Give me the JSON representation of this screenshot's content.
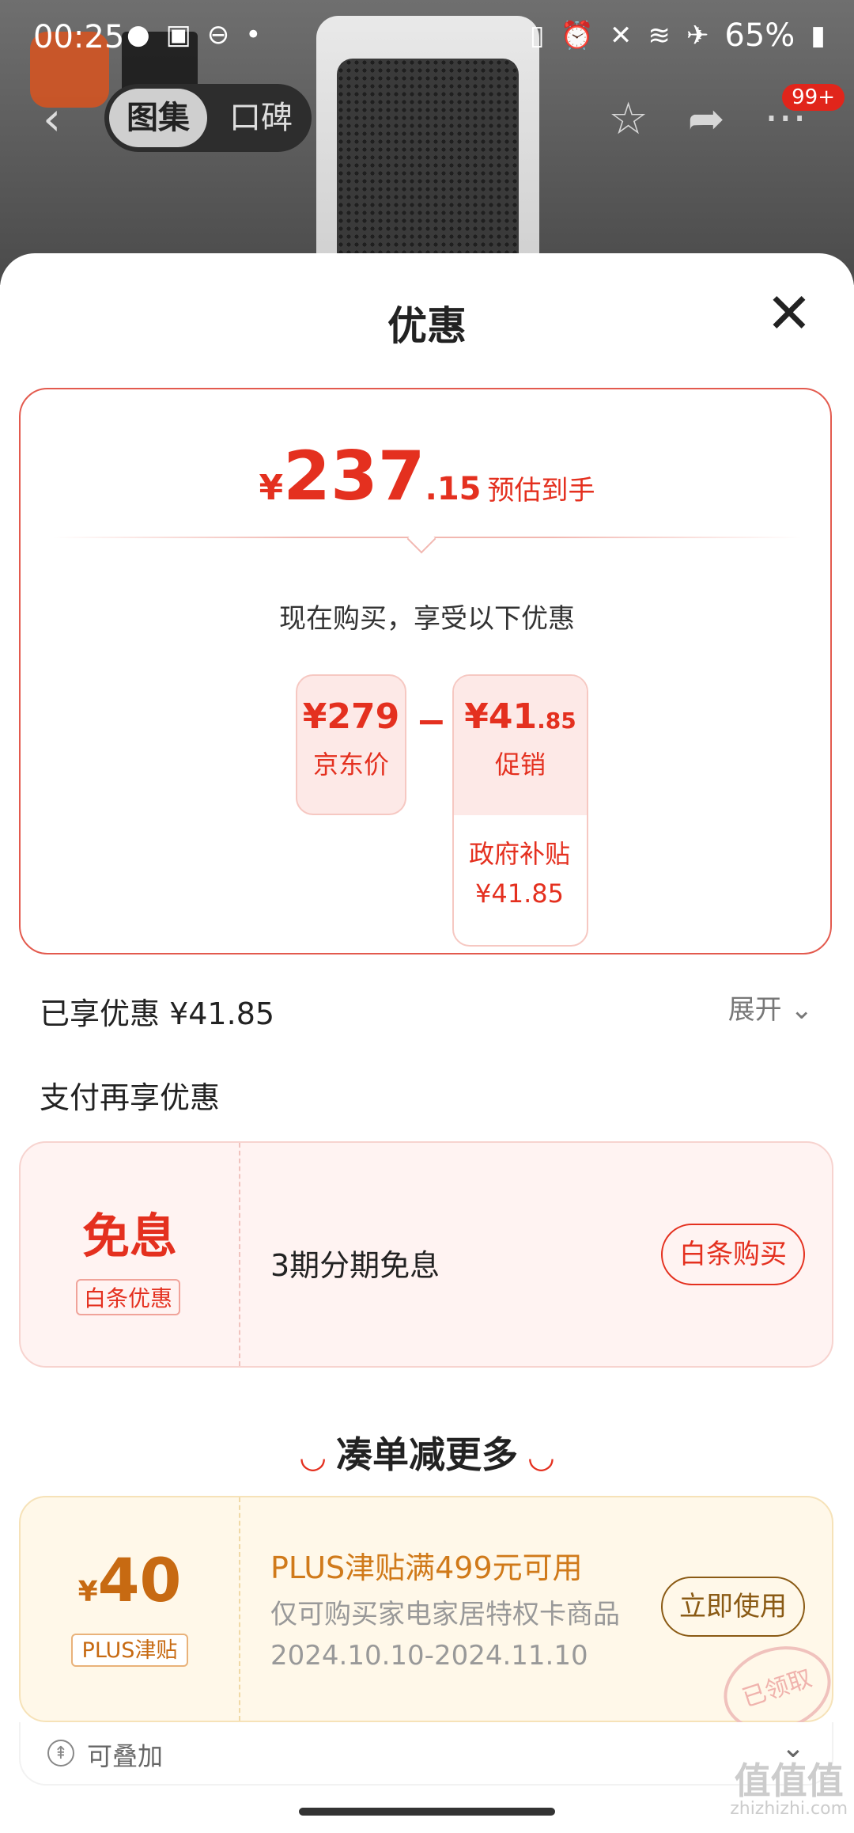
{
  "status_bar": {
    "time": "00:25",
    "battery": "65%"
  },
  "nav": {
    "tab_gallery": "图集",
    "tab_reviews": "口碑",
    "badge": "99+"
  },
  "sheet": {
    "title": "优惠"
  },
  "price": {
    "yen": "¥",
    "int": "237",
    "dec": ".15",
    "label": "预估到手",
    "now_text": "现在购买，享受以下优惠",
    "jd_price": "¥279",
    "jd_label": "京东价",
    "promo_int": "¥41",
    "promo_dec": ".85",
    "promo_label": "促销",
    "gov_label": "政府补贴",
    "gov_amount": "¥41.85"
  },
  "enjoyed": {
    "text": "已享优惠 ¥41.85",
    "expand": "展开"
  },
  "pay": {
    "title": "支付再享优惠",
    "big": "免息",
    "tag": "白条优惠",
    "text": "3期分期免息",
    "button": "白条购买"
  },
  "more": {
    "title": "凑单减更多"
  },
  "plus": {
    "yen": "¥",
    "amount": "40",
    "tag": "PLUS津贴",
    "title": "PLUS津贴满499元可用",
    "desc": "仅可购买家电家居特权卡商品",
    "date": "2024.10.10-2024.11.10",
    "button": "立即使用",
    "stamp": "已领取"
  },
  "stack": {
    "text": "可叠加"
  },
  "watermark": {
    "main": "值值值",
    "sub": "zhizhizhi.com"
  }
}
